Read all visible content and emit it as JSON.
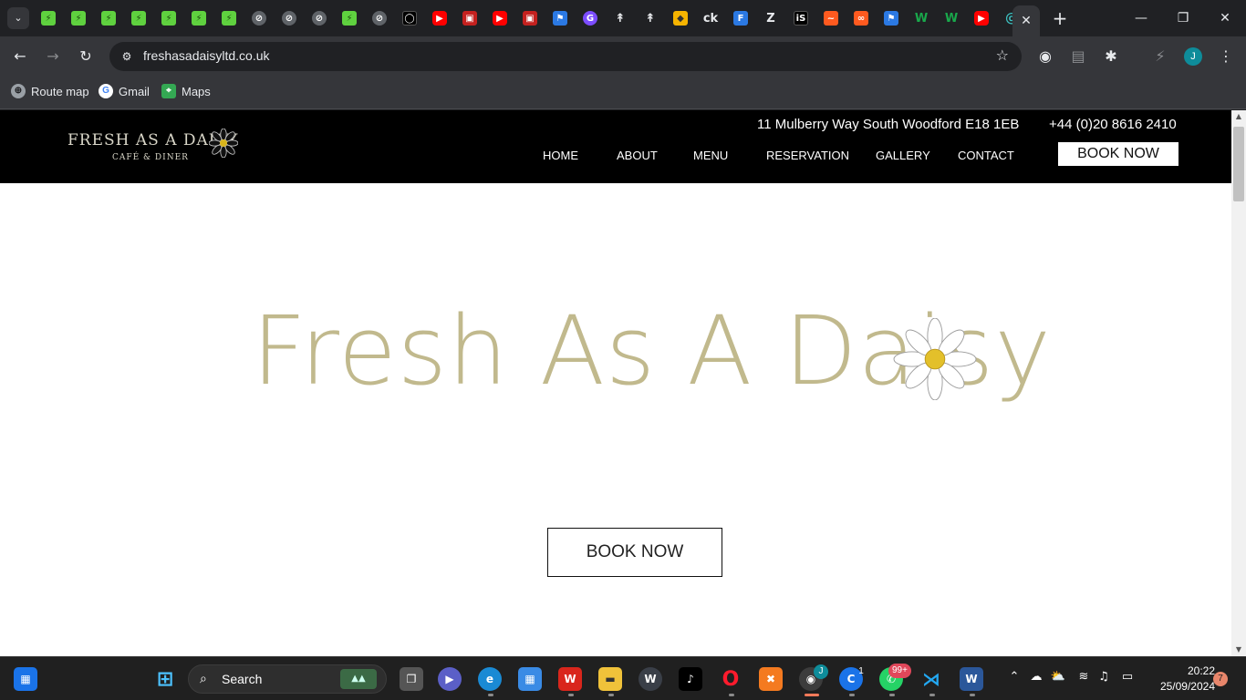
{
  "browser": {
    "tabs": [
      {
        "icon": "green-app-icon",
        "glyph": "⚡"
      },
      {
        "icon": "green-app-icon",
        "glyph": "⚡"
      },
      {
        "icon": "green-app-icon",
        "glyph": "⚡"
      },
      {
        "icon": "green-app-icon",
        "glyph": "⚡"
      },
      {
        "icon": "green-app-icon",
        "glyph": "⚡"
      },
      {
        "icon": "green-app-icon",
        "glyph": "⚡"
      },
      {
        "icon": "green-app-icon",
        "glyph": "⚡"
      },
      {
        "icon": "globe-icon",
        "glyph": "⊘"
      },
      {
        "icon": "globe-icon",
        "glyph": "⊘"
      },
      {
        "icon": "globe-icon",
        "glyph": "⊘"
      },
      {
        "icon": "green-app-icon",
        "glyph": "⚡"
      },
      {
        "icon": "globe-icon",
        "glyph": "⊘"
      },
      {
        "icon": "github-icon",
        "glyph": "◯"
      },
      {
        "icon": "youtube-icon",
        "glyph": "▶"
      },
      {
        "icon": "red-app-icon",
        "glyph": "▣"
      },
      {
        "icon": "youtube-icon",
        "glyph": "▶"
      },
      {
        "icon": "red-app-icon",
        "glyph": "▣"
      },
      {
        "icon": "flag-icon",
        "glyph": "⚑"
      },
      {
        "icon": "grammarly-icon",
        "glyph": "G"
      },
      {
        "icon": "pin-icon",
        "glyph": "↟"
      },
      {
        "icon": "pin-icon",
        "glyph": "↟"
      },
      {
        "icon": "course-icon",
        "glyph": "◆"
      },
      {
        "icon": "ck-icon",
        "glyph": "ck"
      },
      {
        "icon": "form-icon",
        "glyph": "F"
      },
      {
        "icon": "zb-icon",
        "glyph": "Z"
      },
      {
        "icon": "is-icon",
        "glyph": "iS"
      },
      {
        "icon": "orange-app-icon",
        "glyph": "~"
      },
      {
        "icon": "link-icon",
        "glyph": "∞"
      },
      {
        "icon": "flag-icon",
        "glyph": "⚑"
      },
      {
        "icon": "w-icon",
        "glyph": "W"
      },
      {
        "icon": "w-icon",
        "glyph": "W"
      },
      {
        "icon": "youtube-icon",
        "glyph": "▶"
      },
      {
        "icon": "spiral-icon",
        "glyph": "@"
      }
    ],
    "url": "freshasadaisyltd.co.uk",
    "bookmarks": [
      {
        "label": "Route map",
        "icon": "route-map-icon"
      },
      {
        "label": "Gmail",
        "icon": "google-icon"
      },
      {
        "label": "Maps",
        "icon": "maps-icon"
      }
    ],
    "profile_initial": "J"
  },
  "site": {
    "logo_text": "FRESH AS A DAISY",
    "logo_subtitle": "CAFÉ & DINER",
    "address": "11 Mulberry Way South Woodford E18 1EB",
    "phone": "+44 (0)20 8616 2410",
    "nav": [
      "HOME",
      "ABOUT",
      "MENU",
      "RESERVATION",
      "GALLERY",
      "CONTACT"
    ],
    "header_cta": "BOOK NOW",
    "hero_title": "Fresh As A Daisy",
    "hero_cta": "BOOK NOW",
    "brand_color": "#c1b98d"
  },
  "taskbar": {
    "search_label": "Search",
    "chrome_badge": "1",
    "whatsapp_badge": "99+",
    "notification_count": "7",
    "time": "20:22",
    "date": "25/09/2024"
  }
}
